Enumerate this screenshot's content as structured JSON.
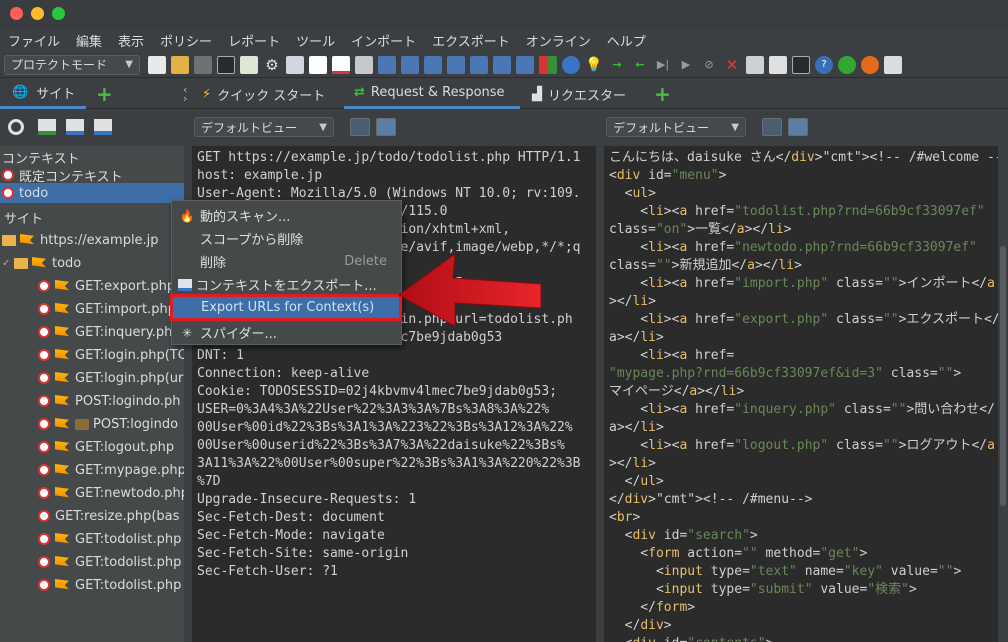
{
  "menu": [
    "ファイル",
    "編集",
    "表示",
    "ポリシー",
    "レポート",
    "ツール",
    "インポート",
    "エクスポート",
    "オンライン",
    "ヘルプ"
  ],
  "toolbar": {
    "mode": "プロテクトモード"
  },
  "tabs": {
    "sites": "サイト",
    "quick_start": "クイック スタート",
    "request_response": "Request & Response",
    "requester": "リクエスター"
  },
  "views": {
    "left_view": "デフォルトビュー",
    "right_view": "デフォルトビュー"
  },
  "tree": {
    "contexts_header": "コンテキスト",
    "default_context": "既定コンテキスト",
    "todo_context": "todo",
    "sites_header": "サイト",
    "site": "https://example.jp",
    "folder": "todo",
    "nodes": [
      "GET:export.php",
      "GET:import.php",
      "GET:inquery.php",
      "GET:login.php(TO",
      "GET:login.php(ur",
      "POST:logindo.ph",
      "POST:logindo",
      "GET:logout.php",
      "GET:mypage.php",
      "GET:newtodo.php",
      "GET:resize.php(bas",
      "GET:todolist.php",
      "GET:todolist.php",
      "GET:todolist.php"
    ]
  },
  "context_menu": {
    "items": [
      "動的スキャン...",
      "スコープから削除",
      "削除",
      "コンテキストをエクスポート...",
      "Export URLs for Context(s)",
      "スパイダー..."
    ],
    "delete_shortcut": "Delete"
  },
  "request_lines": [
    "GET https://example.jp/todo/todolist.php HTTP/1.1",
    "host: example.jp",
    "User-Agent: Mozilla/5.0 (Windows NT 10.0; rv:109.",
    "                          /115.0",
    "                         tion/xhtml+xml,",
    "                         ge/avif,image/webp,*/*;q",
    "",
    "                             q=0.5",
    "",
    "                         gin.php?url=todolist.ph",
    "                         ec7be9jdab0g53",
    "DNT: 1",
    "Connection: keep-alive",
    "Cookie: TODOSESSID=02j4kbvmv4lmec7be9jdab0g53;",
    "USER=0%3A4%3A%22User%22%3A3%3A%7Bs%3A8%3A%22%",
    "00User%00id%22%3Bs%3A1%3A%223%22%3Bs%3A12%3A%22%",
    "00User%00userid%22%3Bs%3A7%3A%22daisuke%22%3Bs%",
    "3A11%3A%22%00User%00super%22%3Bs%3A1%3A%220%22%3B",
    "%7D",
    "Upgrade-Insecure-Requests: 1",
    "Sec-Fetch-Dest: document",
    "Sec-Fetch-Mode: navigate",
    "Sec-Fetch-Site: same-origin",
    "Sec-Fetch-User: ?1"
  ],
  "response_lines": [
    "こんにちは、daisuke さん</div><!-- /#welcome -->",
    "<div id=\"menu\">",
    "  <ul>",
    "    <li><a href=\"todolist.php?rnd=66b9cf33097ef\"",
    "class=\"on\">一覧</a></li>",
    "    <li><a href=\"newtodo.php?rnd=66b9cf33097ef\"",
    "class=\"\">新規追加</a></li>",
    "    <li><a href=\"import.php\" class=\"\">インポート</a",
    "></li>",
    "    <li><a href=\"export.php\" class=\"\">エクスポート</",
    "a></li>",
    "    <li><a href=",
    "\"mypage.php?rnd=66b9cf33097ef&id=3\" class=\"\">",
    "マイページ</a></li>",
    "    <li><a href=\"inquery.php\" class=\"\">問い合わせ</",
    "a></li>",
    "    <li><a href=\"logout.php\" class=\"\">ログアウト</a",
    "></li>",
    "  </ul>",
    "</div><!-- /#menu-->",
    "<br>",
    "  <div id=\"search\">",
    "    <form action=\"\" method=\"get\">",
    "      <input type=\"text\" name=\"key\" value=\"\">",
    "      <input type=\"submit\" value=\"検索\">",
    "    </form>",
    "  </div>",
    "  <div id=\"contents\">"
  ],
  "colors": {
    "selection": "#3d6ea8",
    "highlight_border": "#e01b24",
    "arrow": "#d9141b"
  }
}
